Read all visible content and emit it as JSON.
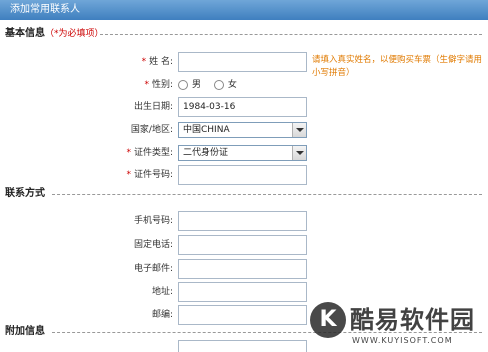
{
  "window": {
    "title": "添加常用联系人"
  },
  "basic_info": {
    "heading": "基本信息",
    "required_note": "（*为必填项）",
    "name_label": "姓  名:",
    "name_value": "",
    "name_hint": "请填入真实姓名，以便购买车票（生僻字请用小写拼音）",
    "gender_label": "性别:",
    "gender_options": [
      "男",
      "女"
    ],
    "birth_label": "出生日期:",
    "birth_value": "1984-03-16",
    "country_label": "国家/地区:",
    "country_value": "中国CHINA",
    "id_type_label": "证件类型:",
    "id_type_value": "二代身份证",
    "id_no_label": "证件号码:",
    "id_no_value": ""
  },
  "contact": {
    "heading": "联系方式",
    "mobile_label": "手机号码:",
    "phone_label": "固定电话:",
    "email_label": "电子邮件:",
    "address_label": "地址:",
    "postcode_label": "邮编:"
  },
  "extra": {
    "heading": "附加信息"
  },
  "watermark": {
    "text": "酷易软件园",
    "logo": "K",
    "url": "WWW.KUYISOFT.COM"
  },
  "required_mark": "*"
}
